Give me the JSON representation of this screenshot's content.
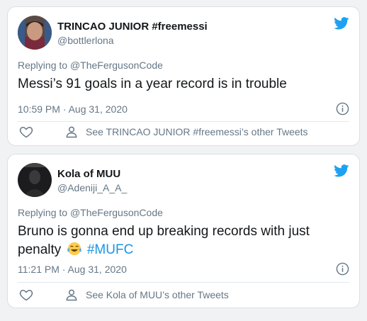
{
  "tweets": [
    {
      "author_name": "TRINCAO JUNIOR #freemessi",
      "handle": "@bottlerlona",
      "replying_prefix": "Replying to ",
      "replying_to": "@TheFergusonCode",
      "text": "Messi’s 91 goals in a year  record is in trouble",
      "timestamp": "10:59 PM · Aug 31, 2020",
      "other_tweets_label": "See TRINCAO JUNIOR #freemessi’s other Tweets"
    },
    {
      "author_name": "Kola of MUU",
      "handle": "@Adeniji_A_A_",
      "replying_prefix": "Replying to ",
      "replying_to": "@TheFergusonCode",
      "text_line1": "Bruno is gonna end up breaking records with just",
      "text_line2": "penalty",
      "emoji": "face-with-tears-of-joy",
      "hashtag": "#MUFC",
      "timestamp": "11:21 PM · Aug 31, 2020",
      "other_tweets_label": "See Kola of MUU’s other Tweets"
    }
  ],
  "colors": {
    "twitter_blue": "#1da1f2",
    "hashtag": "#1b95e0",
    "secondary_text": "#657786",
    "primary_text": "#14171a"
  },
  "icons": [
    "twitter-bird-icon",
    "info-icon",
    "heart-icon",
    "person-icon",
    "tears-of-joy-emoji"
  ]
}
